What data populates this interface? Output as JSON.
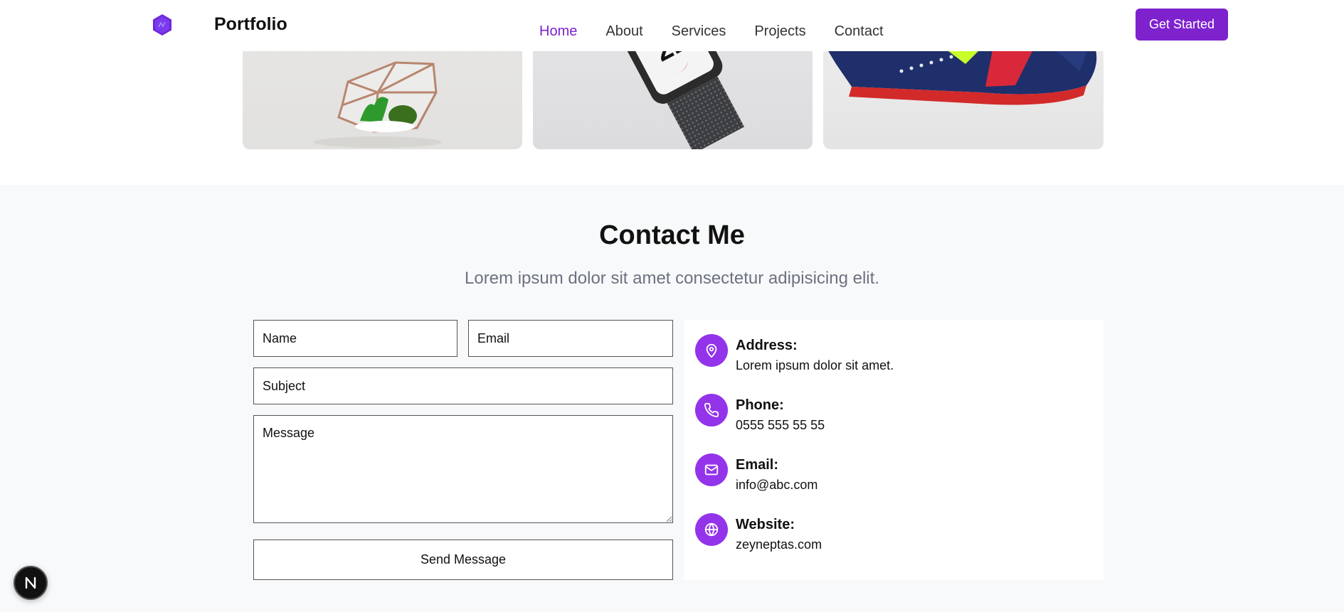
{
  "header": {
    "brand": "Portfolio",
    "nav": [
      "Home",
      "About",
      "Services",
      "Projects",
      "Contact"
    ],
    "active_nav": "Home",
    "cta_label": "Get Started"
  },
  "contact": {
    "title": "Contact Me",
    "subtitle": "Lorem ipsum dolor sit amet consectetur adipisicing elit.",
    "form": {
      "name_placeholder": "Name",
      "email_placeholder": "Email",
      "subject_placeholder": "Subject",
      "message_placeholder": "Message",
      "send_label": "Send Message"
    },
    "info": [
      {
        "label": "Address:",
        "value": "Lorem ipsum dolor sit amet.",
        "icon": "map-pin-icon"
      },
      {
        "label": "Phone:",
        "value": "0555 555 55 55",
        "icon": "phone-icon"
      },
      {
        "label": "Email:",
        "value": "info@abc.com",
        "icon": "mail-icon"
      },
      {
        "label": "Website:",
        "value": "zeyneptas.com",
        "icon": "globe-icon"
      }
    ]
  },
  "colors": {
    "accent": "#7e22ce",
    "icon_bg": "#9333ea",
    "section_bg": "#f8f9fa",
    "subtitle": "#6b7280"
  }
}
